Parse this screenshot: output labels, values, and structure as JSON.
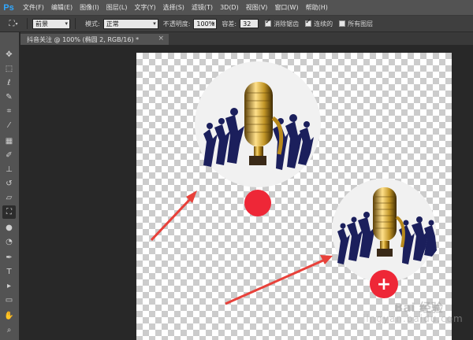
{
  "app": {
    "logo": "Ps",
    "menu": [
      "文件(F)",
      "编辑(E)",
      "图像(I)",
      "图层(L)",
      "文字(Y)",
      "选择(S)",
      "滤镜(T)",
      "3D(D)",
      "视图(V)",
      "窗口(W)",
      "帮助(H)"
    ]
  },
  "options": {
    "fill_source": "前景",
    "mode_label": "模式:",
    "mode_value": "正常",
    "opacity_label": "不透明度:",
    "opacity_value": "100%",
    "tolerance_label": "容差:",
    "tolerance_value": "32",
    "antialias_label": "消除锯齿",
    "antialias_checked": true,
    "contiguous_label": "连续的",
    "contiguous_checked": true,
    "all_layers_label": "所有图层",
    "all_layers_checked": false
  },
  "document": {
    "tab_title": "抖音关注 @ 100% (椭圆 2, RGB/16) *",
    "close_glyph": "×"
  },
  "toolbar": {
    "tools": [
      {
        "name": "move-tool-icon",
        "glyph": "✥"
      },
      {
        "name": "marquee-tool-icon",
        "glyph": "⬚"
      },
      {
        "name": "lasso-tool-icon",
        "glyph": "ℓ"
      },
      {
        "name": "quick-select-tool-icon",
        "glyph": "✎"
      },
      {
        "name": "crop-tool-icon",
        "glyph": "⌗"
      },
      {
        "name": "eyedropper-tool-icon",
        "glyph": "⁄"
      },
      {
        "name": "healing-brush-tool-icon",
        "glyph": "▦"
      },
      {
        "name": "brush-tool-icon",
        "glyph": "✐"
      },
      {
        "name": "stamp-tool-icon",
        "glyph": "⊥"
      },
      {
        "name": "history-brush-tool-icon",
        "glyph": "↺"
      },
      {
        "name": "eraser-tool-icon",
        "glyph": "▱"
      },
      {
        "name": "paint-bucket-tool-icon",
        "glyph": "⛶"
      },
      {
        "name": "blur-tool-icon",
        "glyph": "●"
      },
      {
        "name": "dodge-tool-icon",
        "glyph": "◔"
      },
      {
        "name": "pen-tool-icon",
        "glyph": "✒"
      },
      {
        "name": "type-tool-icon",
        "glyph": "T"
      },
      {
        "name": "path-select-tool-icon",
        "glyph": "▸"
      },
      {
        "name": "shape-tool-icon",
        "glyph": "▭"
      },
      {
        "name": "hand-tool-icon",
        "glyph": "✋"
      },
      {
        "name": "zoom-tool-icon",
        "glyph": "⌕"
      }
    ]
  },
  "artwork": {
    "plus_glyph": "+",
    "accent_red": "#ee2737",
    "arrow_red": "#e8413a"
  },
  "watermark": {
    "main": "Bai 经验",
    "sub": "jingyan.baidu.com"
  }
}
